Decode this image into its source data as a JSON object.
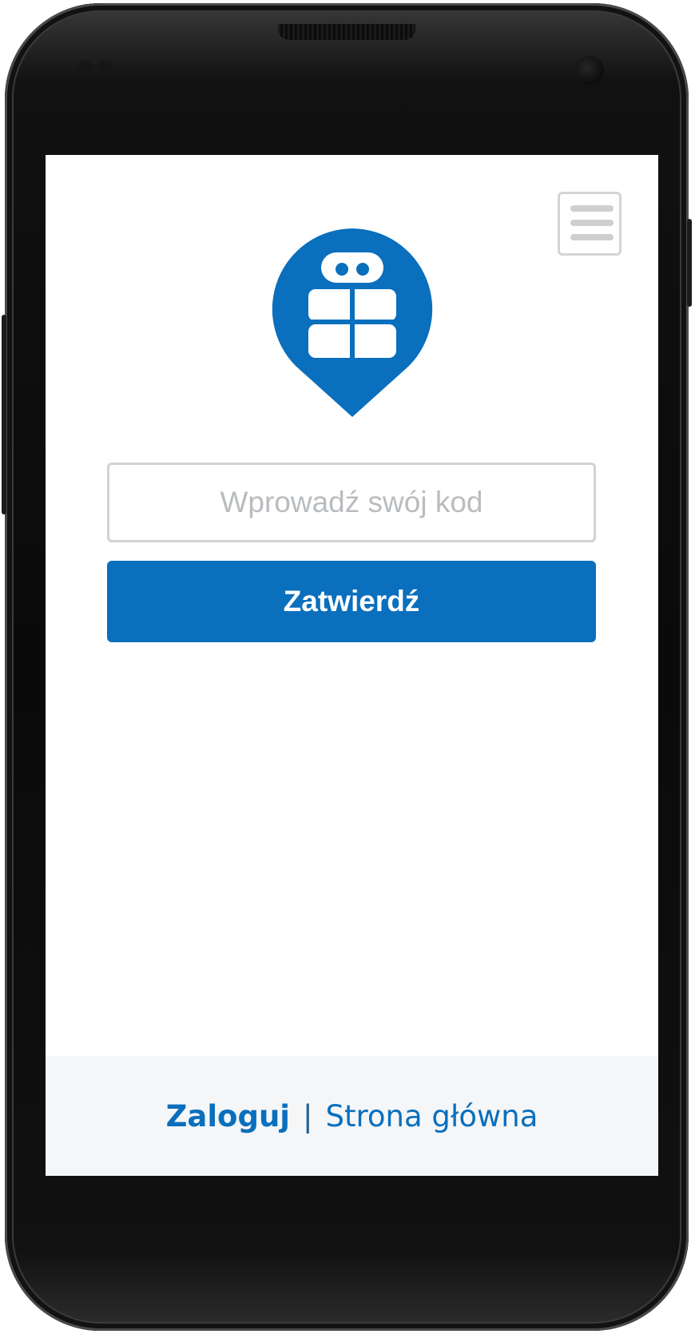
{
  "theme": {
    "accent": "#0a6fbd",
    "footer_background": "#f4f6f8",
    "border_gray": "#d2d2d2",
    "placeholder_gray": "#b9bcbf"
  },
  "header": {
    "menu_icon": "hamburger-icon"
  },
  "logo": {
    "icon": "gift-map-pin-icon"
  },
  "form": {
    "code_placeholder": "Wprowadź swój kod",
    "code_value": "",
    "submit_label": "Zatwierdź"
  },
  "footer": {
    "login_label": "Zaloguj",
    "separator": "|",
    "home_label": "Strona główna"
  }
}
